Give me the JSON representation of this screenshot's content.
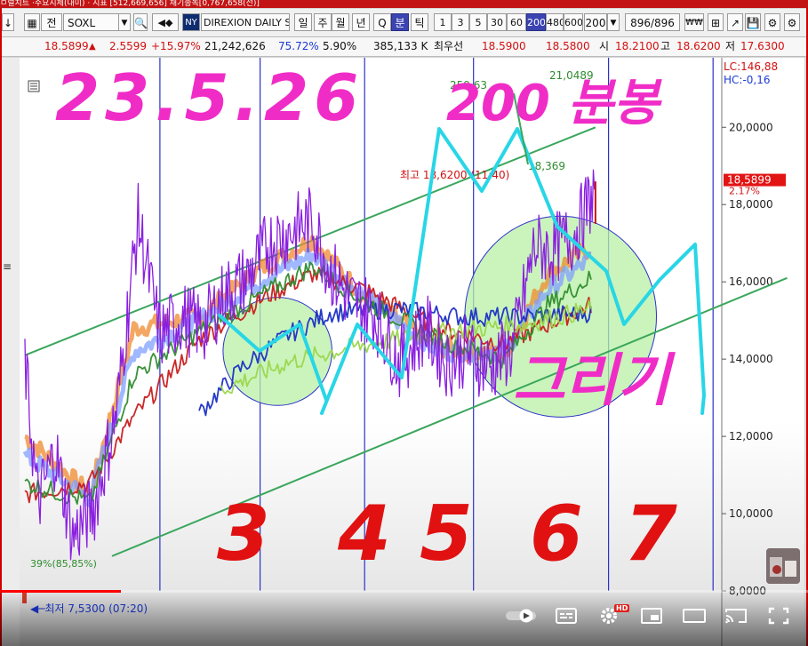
{
  "window": {
    "title_fragment": "ㅁ럴치트 ·주요지체(대미) · 지표 [512,669,656] 채기종녹[0,767,658(전)]"
  },
  "toolbar": {
    "mode_button": "전",
    "ticker": "SOXL",
    "market_badge": "NY",
    "instrument_name": "DIREXION DAILY S",
    "period_buttons": [
      "일",
      "주",
      "월",
      "년",
      "Q",
      "분",
      "틱"
    ],
    "selected_period": "분",
    "interval_buttons": [
      "1",
      "3",
      "5",
      "30",
      "60",
      "200",
      "480",
      "600"
    ],
    "selected_interval": "200",
    "count_value": "200",
    "bar_counter": "896",
    "bar_total": "/896"
  },
  "quote": {
    "price": "18.5899",
    "change": "2.5599",
    "change_pct": "+15.97%",
    "volume": "21,242,626",
    "ratio1": "75.72%",
    "ratio2": "5.90%",
    "amount": "385,133 K",
    "bid_label": "최우선",
    "bid": "18.5900",
    "ask": "18.5800",
    "open_label": "시",
    "open": "18.2100",
    "high_label": "고",
    "high": "18.6200",
    "low_label": "저",
    "low": "17.6300"
  },
  "chart_data": {
    "type": "line",
    "ylim": [
      8.0,
      21.8
    ],
    "yticks": [
      8.0,
      10.0,
      12.0,
      14.0,
      16.0,
      18.0,
      20.0
    ],
    "ytick_labels": [
      "8,0000",
      "10,0000",
      "12,0000",
      "14,0000",
      "16,0000",
      "18,0000",
      "20,0000"
    ],
    "current_price_label": "18,5899",
    "current_pct_label": "2.17%",
    "lc_label": "LC:146,88",
    "hc_label": "HC:-0,16",
    "high_marker_label": "최고 18,6200 (11:40)",
    "low_marker_label": "최저 7,5300 (07:20)",
    "low_pct_label": "39%(85,85%)",
    "top_line_label": "259,63",
    "top_line_label2": "21,0489",
    "mid_label": "18,369",
    "n_bars": 160,
    "price_path": [
      [
        0,
        13.9
      ],
      [
        3,
        10.3
      ],
      [
        7,
        11.6
      ],
      [
        11,
        9.4
      ],
      [
        16,
        10.2
      ],
      [
        21,
        12.6
      ],
      [
        26,
        17.6
      ],
      [
        31,
        14.6
      ],
      [
        36,
        15.1
      ],
      [
        41,
        14.8
      ],
      [
        46,
        15.7
      ],
      [
        51,
        16.1
      ],
      [
        56,
        17.0
      ],
      [
        61,
        17.3
      ],
      [
        66,
        17.6
      ],
      [
        70,
        16.3
      ],
      [
        75,
        15.5
      ],
      [
        80,
        15.2
      ],
      [
        86,
        13.9
      ],
      [
        92,
        14.8
      ],
      [
        97,
        13.9
      ],
      [
        101,
        14.2
      ],
      [
        107,
        13.8
      ],
      [
        112,
        14.3
      ],
      [
        117,
        16.9
      ],
      [
        121,
        16.8
      ],
      [
        126,
        17.2
      ],
      [
        131,
        18.4
      ]
    ],
    "ma_paths": [
      {
        "color": "#f08a2e",
        "pts": [
          [
            0,
            12.0
          ],
          [
            15,
            10.5
          ],
          [
            25,
            14.8
          ],
          [
            40,
            15.1
          ],
          [
            55,
            16.4
          ],
          [
            66,
            17.1
          ],
          [
            78,
            15.6
          ],
          [
            95,
            14.3
          ],
          [
            110,
            14.1
          ],
          [
            120,
            16.2
          ],
          [
            130,
            16.9
          ]
        ]
      },
      {
        "color": "#7fa0ff",
        "pts": [
          [
            0,
            11.5
          ],
          [
            15,
            10.4
          ],
          [
            25,
            14.2
          ],
          [
            40,
            15.0
          ],
          [
            55,
            16.1
          ],
          [
            66,
            16.7
          ],
          [
            78,
            15.6
          ],
          [
            95,
            14.2
          ],
          [
            110,
            14.2
          ],
          [
            120,
            15.8
          ],
          [
            130,
            16.6
          ]
        ]
      },
      {
        "color": "#c71c1c",
        "pts": [
          [
            0,
            10.5
          ],
          [
            15,
            10.8
          ],
          [
            25,
            12.5
          ],
          [
            40,
            14.5
          ],
          [
            55,
            15.6
          ],
          [
            66,
            16.2
          ],
          [
            78,
            15.8
          ],
          [
            95,
            14.8
          ],
          [
            110,
            14.4
          ],
          [
            120,
            14.9
          ],
          [
            130,
            15.4
          ]
        ]
      },
      {
        "color": "#1a2fc4",
        "pts": [
          [
            40,
            12.6
          ],
          [
            50,
            13.8
          ],
          [
            60,
            14.6
          ],
          [
            70,
            15.2
          ],
          [
            85,
            15.3
          ],
          [
            100,
            15.1
          ],
          [
            115,
            15.1
          ],
          [
            130,
            15.2
          ]
        ]
      },
      {
        "color": "#2f8c2f",
        "pts": [
          [
            0,
            10.8
          ],
          [
            15,
            10.3
          ],
          [
            25,
            13.6
          ],
          [
            40,
            14.7
          ],
          [
            55,
            15.7
          ],
          [
            66,
            16.4
          ],
          [
            78,
            15.5
          ],
          [
            95,
            14.5
          ],
          [
            110,
            14.0
          ],
          [
            120,
            15.4
          ],
          [
            130,
            16.1
          ]
        ]
      },
      {
        "color": "#9bd64b",
        "pts": [
          [
            45,
            13.2
          ],
          [
            60,
            13.9
          ],
          [
            75,
            14.3
          ],
          [
            95,
            14.7
          ],
          [
            115,
            14.9
          ],
          [
            130,
            15.3
          ]
        ]
      }
    ],
    "channel_lines": [
      {
        "color": "#3aa65c",
        "pts": [
          [
            0,
            14.1
          ],
          [
            131,
            20.0
          ]
        ]
      },
      {
        "color": "#3aa65c",
        "pts": [
          [
            20,
            8.9
          ],
          [
            175,
            16.1
          ]
        ]
      }
    ],
    "vlines": [
      31,
      54,
      78,
      103,
      134,
      158
    ],
    "circles": [
      {
        "cx": 58,
        "cy": 14.2,
        "rx": 12.5,
        "ry": 1.4
      },
      {
        "cx": 123,
        "cy": 15.1,
        "rx": 22,
        "ry": 2.6
      }
    ],
    "annotations": {
      "pink_text_1": "23.5.26",
      "pink_text_2": "200 분봉",
      "pink_text_3": "그리기",
      "red_numbers": [
        "3",
        "4",
        "5",
        "6",
        "7"
      ]
    }
  },
  "player": {
    "progress_fraction": 0.15,
    "hd_badge": "HD"
  }
}
